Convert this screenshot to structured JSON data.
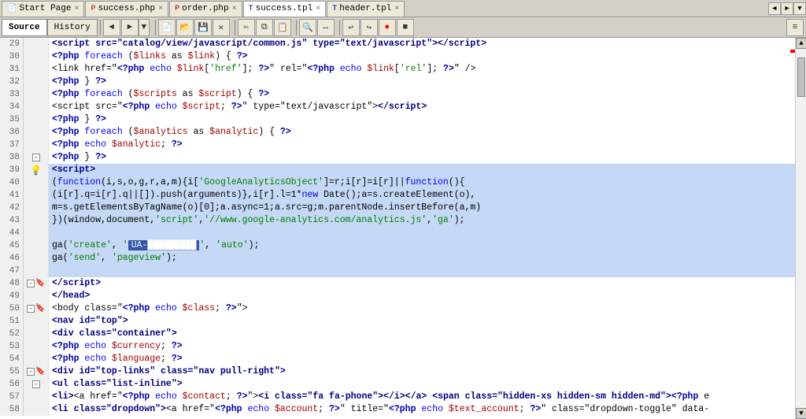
{
  "tabs": [
    {
      "id": "start",
      "label": "Start Page",
      "icon": "page",
      "active": false
    },
    {
      "id": "success_php",
      "label": "success.php",
      "icon": "php",
      "active": false
    },
    {
      "id": "order_php",
      "label": "order.php",
      "icon": "php",
      "active": false
    },
    {
      "id": "success_tpl",
      "label": "success.tpl",
      "icon": "tpl",
      "active": true
    },
    {
      "id": "header_tpl",
      "label": "header.tpl",
      "icon": "tpl",
      "active": false
    }
  ],
  "toolbar": {
    "source_label": "Source",
    "history_label": "History"
  },
  "lines": [
    {
      "num": 29,
      "fold": false,
      "bulb": false,
      "bookmark": false,
      "highlighted": false,
      "content": "    &lt;script src=\"catalog/view/javascript/common.js\" type=\"text/javascript\"&gt;&lt;/script&gt;"
    },
    {
      "num": 30,
      "fold": false,
      "bulb": false,
      "bookmark": false,
      "highlighted": false,
      "content": "    &lt;?php foreach ($links as $link) { ?&gt;"
    },
    {
      "num": 31,
      "fold": false,
      "bulb": false,
      "bookmark": false,
      "highlighted": false,
      "content": "    &lt;link href=\"&lt;?php echo $link['href']; ?&gt;\" rel=\"&lt;?php echo $link['rel']; ?&gt;\" /&gt;"
    },
    {
      "num": 32,
      "fold": false,
      "bulb": false,
      "bookmark": false,
      "highlighted": false,
      "content": "    &lt;?php } ?&gt;"
    },
    {
      "num": 33,
      "fold": false,
      "bulb": false,
      "bookmark": false,
      "highlighted": false,
      "content": "    &lt;?php foreach ($scripts as $script) { ?&gt;"
    },
    {
      "num": 34,
      "fold": false,
      "bulb": false,
      "bookmark": false,
      "highlighted": false,
      "content": "    &lt;script src=\"&lt;?php echo $script; ?&gt;\" type=\"text/javascript\"&gt;&lt;/script&gt;"
    },
    {
      "num": 35,
      "fold": false,
      "bulb": false,
      "bookmark": false,
      "highlighted": false,
      "content": "    &lt;?php } ?&gt;"
    },
    {
      "num": 36,
      "fold": false,
      "bulb": false,
      "bookmark": false,
      "highlighted": false,
      "content": "    &lt;?php foreach ($analytics as $analytic) { ?&gt;"
    },
    {
      "num": 37,
      "fold": false,
      "bulb": false,
      "bookmark": false,
      "highlighted": false,
      "content": "    &lt;?php echo $analytic; ?&gt;"
    },
    {
      "num": 38,
      "fold": true,
      "bulb": false,
      "bookmark": false,
      "highlighted": false,
      "content": "    &lt;?php } ?&gt;"
    },
    {
      "num": 39,
      "fold": false,
      "bulb": true,
      "bookmark": false,
      "highlighted": true,
      "content": "    &lt;script&gt;"
    },
    {
      "num": 40,
      "fold": false,
      "bulb": false,
      "bookmark": false,
      "highlighted": true,
      "content": "      (function(i,s,o,g,r,a,m){i['GoogleAnalyticsObject']=r;i[r]=i[r]||function(){"
    },
    {
      "num": 41,
      "fold": false,
      "bulb": false,
      "bookmark": false,
      "highlighted": true,
      "content": "      (i[r].q=i[r].q||[]).push(arguments)},i[r].l=1*new Date();a=s.createElement(o),"
    },
    {
      "num": 42,
      "fold": false,
      "bulb": false,
      "bookmark": false,
      "highlighted": true,
      "content": "      m=s.getElementsByTagName(o)[0];a.async=1;a.src=g;m.parentNode.insertBefore(a,m)"
    },
    {
      "num": 43,
      "fold": false,
      "bulb": false,
      "bookmark": false,
      "highlighted": true,
      "content": "      })(window,document,'script','//www.google-analytics.com/analytics.js','ga');"
    },
    {
      "num": 44,
      "fold": false,
      "bulb": false,
      "bookmark": false,
      "highlighted": true,
      "content": ""
    },
    {
      "num": 45,
      "fold": false,
      "bulb": false,
      "bookmark": false,
      "highlighted": true,
      "content": "      ga('create', 'UA-█████████', 'auto');"
    },
    {
      "num": 46,
      "fold": false,
      "bulb": false,
      "bookmark": false,
      "highlighted": true,
      "content": "      ga('send', 'pageview');"
    },
    {
      "num": 47,
      "fold": false,
      "bulb": false,
      "bookmark": false,
      "highlighted": true,
      "content": ""
    },
    {
      "num": 48,
      "fold": true,
      "bulb": false,
      "bookmark": true,
      "highlighted": false,
      "content": "    &lt;/script&gt;"
    },
    {
      "num": 49,
      "fold": false,
      "bulb": false,
      "bookmark": false,
      "highlighted": false,
      "content": "    &lt;/head&gt;"
    },
    {
      "num": 50,
      "fold": true,
      "bulb": false,
      "bookmark": true,
      "highlighted": false,
      "content": "    &lt;body class=\"&lt;?php echo $class; ?&gt;\"&gt;"
    },
    {
      "num": 51,
      "fold": false,
      "bulb": false,
      "bookmark": false,
      "highlighted": false,
      "content": "    &lt;nav id=\"top\"&gt;"
    },
    {
      "num": 52,
      "fold": false,
      "bulb": false,
      "bookmark": false,
      "highlighted": false,
      "content": "      &lt;div class=\"container\"&gt;"
    },
    {
      "num": 53,
      "fold": false,
      "bulb": false,
      "bookmark": false,
      "highlighted": false,
      "content": "        &lt;?php echo $currency; ?&gt;"
    },
    {
      "num": 54,
      "fold": false,
      "bulb": false,
      "bookmark": false,
      "highlighted": false,
      "content": "        &lt;?php echo $language; ?&gt;"
    },
    {
      "num": 55,
      "fold": true,
      "bulb": false,
      "bookmark": true,
      "highlighted": false,
      "content": "        &lt;div id=\"top-links\" class=\"nav pull-right\"&gt;"
    },
    {
      "num": 56,
      "fold": true,
      "bulb": false,
      "bookmark": false,
      "highlighted": false,
      "content": "          &lt;ul class=\"list-inline\"&gt;"
    },
    {
      "num": 57,
      "fold": false,
      "bulb": false,
      "bookmark": false,
      "highlighted": false,
      "content": "            &lt;li&gt;&lt;a href=\"&lt;?php echo $contact; ?&gt;\"&gt;&lt;i class=\"fa fa-phone\"&gt;&lt;/i&gt;&lt;/a&gt; &lt;span class=\"hidden-xs hidden-sm hidden-md\"&gt;&lt;?php e"
    },
    {
      "num": 58,
      "fold": false,
      "bulb": false,
      "bookmark": false,
      "highlighted": false,
      "content": "            &lt;li class=\"dropdown\"&gt;&lt;a href=\"&lt;?php echo $account; ?&gt;\" title=\"&lt;?php echo $text_account; ?&gt;\" class=\"dropdown-toggle\" data-"
    }
  ],
  "colors": {
    "accent_blue": "#0000ff",
    "highlight_bg": "#c5d8f5",
    "gutter_bg": "#f0f0f0",
    "toolbar_bg": "#d4d0c8",
    "tab_active_bg": "#ffffff",
    "error_red": "#cc0000"
  }
}
